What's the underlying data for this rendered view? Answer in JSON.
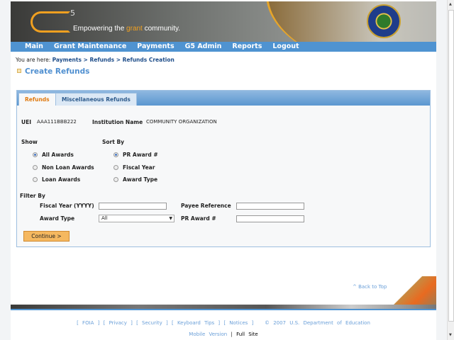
{
  "header": {
    "logo": "G5",
    "tagline_pre": "Empowering the ",
    "tagline_hl": "grant",
    "tagline_post": " community."
  },
  "nav": [
    "Main",
    "Grant Maintenance",
    "Payments",
    "G5 Admin",
    "Reports",
    "Logout"
  ],
  "breadcrumb": {
    "prefix": "You are here: ",
    "path": "Payments > Refunds > Refunds Creation"
  },
  "page_title": "Create Refunds",
  "tabs": [
    {
      "label": "Refunds",
      "active": true
    },
    {
      "label": "Miscellaneous Refunds",
      "active": false
    }
  ],
  "info": {
    "uei_label": "UEI",
    "uei": "AAA111BBB222",
    "inst_label": "Institution Name",
    "inst": "COMMUNITY ORGANIZATION"
  },
  "show": {
    "label": "Show",
    "options": [
      "All Awards",
      "Non Loan Awards",
      "Loan Awards"
    ],
    "selected": 0
  },
  "sort": {
    "label": "Sort By",
    "options": [
      "PR Award #",
      "Fiscal Year",
      "Award Type"
    ],
    "selected": 0
  },
  "filter": {
    "label": "Filter By",
    "fiscal_year": "Fiscal Year (YYYY)",
    "payee": "Payee Reference",
    "award_type": "Award Type",
    "award_type_value": "All",
    "pr_award": "PR Award #"
  },
  "continue": "Continue >",
  "back_to_top": "^ Back to Top",
  "footer": {
    "links": "[ FOIA ] [ Privacy ] [ Security ] [ Keyboard Tips ] [ Notices ]",
    "copyright": "© 2007 U.S. Department of Education",
    "mobile": "Mobile Version",
    "sep": "|",
    "full": "Full Site"
  }
}
